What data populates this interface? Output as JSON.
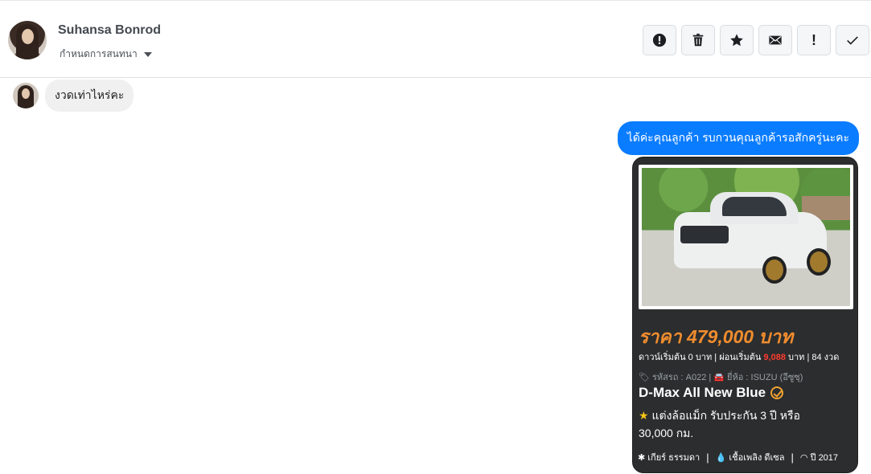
{
  "header": {
    "contact_name": "Suhansa Bonrod",
    "assign_label": "กำหนดการสนทนา",
    "toolbar": [
      {
        "icon": "alert-circle-icon",
        "glyph": "!"
      },
      {
        "icon": "trash-icon"
      },
      {
        "icon": "star-icon"
      },
      {
        "icon": "envelope-icon"
      },
      {
        "icon": "exclamation-icon",
        "glyph": "!"
      },
      {
        "icon": "check-icon"
      }
    ]
  },
  "messages": {
    "incoming": "งวดเท่าไหร่คะ",
    "outgoing": "ได้ค่ะคุณลูกค้า รบกวนคุณลูกค้ารอสักครู่นะคะ"
  },
  "card": {
    "price": "ราคา 479,000 บาท",
    "terms_prefix": "ดาวน์เริ่มต้น 0 บาท | ผ่อนเริ่มต้น ",
    "terms_installment": "9,088",
    "terms_suffix": " บาท | 84 งวด",
    "meta": "🏷 รหัสรถ : A022 | 🚘 ยี่ห้อ : ISUZU (อีซูซุ)",
    "title": "D-Max All New Blue",
    "desc_star": "★",
    "description": "แต่งล้อแม็ก รับประกัน 3 ปี หรือ 30,000 กม.",
    "spec_gear": "✱ เกียร์ ธรรมดา",
    "spec_fuel": "💧 เชื้อเพลิง ดีเซล",
    "spec_year": "◠ ปี 2017",
    "spec_sep": "|"
  },
  "colors": {
    "outgoing_bubble": "#0a7cff",
    "incoming_bubble": "#f0f0f0",
    "card_bg": "#2b2d2e",
    "price": "#f08c2e",
    "installment": "#ff3b30"
  }
}
